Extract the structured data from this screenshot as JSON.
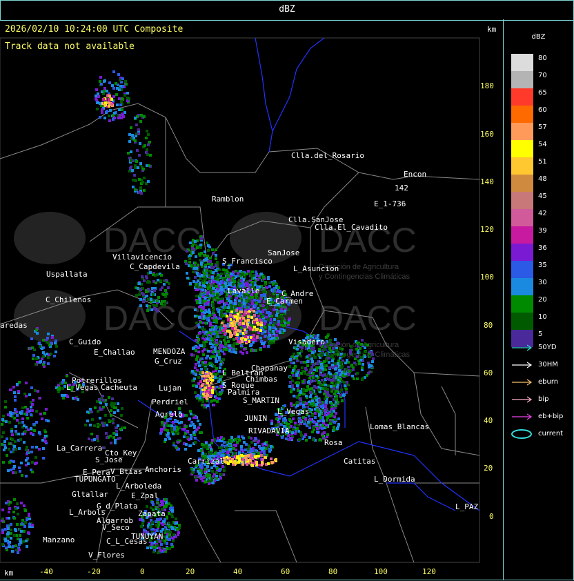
{
  "window": {
    "title": "dBZ"
  },
  "header": {
    "timestamp": "2026/02/10 10:24:00 UTC Composite",
    "track_message": "Track data not available",
    "km_label_top": "km",
    "km_label_bottom": "km"
  },
  "axes": {
    "x_ticks": [
      "-40",
      "-20",
      "0",
      "20",
      "40",
      "60",
      "80",
      "100",
      "120"
    ],
    "y_ticks": [
      "180",
      "160",
      "140",
      "120",
      "100",
      "80",
      "60",
      "40",
      "20",
      "0"
    ]
  },
  "watermark": {
    "brand": "DACC",
    "subtitle_line1": "Dirección de Agricultura",
    "subtitle_line2": "y Contingencias Climáticas"
  },
  "places": [
    "Clla.del_Rosario",
    "Encon",
    "E_1-736",
    "142",
    "Ramblon",
    "Clla.SanJose",
    "Clla.El_Cavadito",
    "Villavicencio",
    "C_Capdevila",
    "S_Francisco",
    "SanJose",
    "L_Asuncion",
    "Uspallata",
    "C_Chilenos",
    "Lavalle",
    "C_Andre",
    "E_Carmen",
    "aredas",
    "MENDOZA",
    "C_Guido",
    "E_Challao",
    "G_Cruz",
    "Visadero",
    "Chapanay",
    "Potrerillos",
    "L_Vegas",
    "Cacheuta",
    "Lujan",
    "Perdriel",
    "L_Beltran",
    "S_Roque",
    "Chimbas",
    "Palmira",
    "S_MARTIN",
    "JUNIN",
    "Agrelo",
    "L_Vegas",
    "RIVADAVIA",
    "Lomas_Blancas",
    "La_Carrera",
    "Cto_Key",
    "S_Jose",
    "E_Pera",
    "TUPUNGATO",
    "V_Btias",
    "Anchoris",
    "Catitas",
    "L_Dormida",
    "Carrizal",
    "Rosa",
    "L_Arboleda",
    "E_Zpal",
    "Gltallar",
    "G_d_Plata",
    "L_Arbols",
    "Algarrob",
    "V_Seco",
    "Zapata",
    "TUNUYAN",
    "C_L_Cesas",
    "Manzano",
    "V_Flores",
    "L_PAZ"
  ],
  "legend": {
    "title": "dBZ",
    "levels": [
      {
        "label": "80",
        "color": "#dcdcdc"
      },
      {
        "label": "70",
        "color": "#b4b4b4"
      },
      {
        "label": "65",
        "color": "#ff3a2a"
      },
      {
        "label": "60",
        "color": "#ff6a00"
      },
      {
        "label": "57",
        "color": "#ff9a5a"
      },
      {
        "label": "54",
        "color": "#ffff00"
      },
      {
        "label": "51",
        "color": "#ffc830"
      },
      {
        "label": "48",
        "color": "#d08a40"
      },
      {
        "label": "45",
        "color": "#c87878"
      },
      {
        "label": "42",
        "color": "#d05a9a"
      },
      {
        "label": "39",
        "color": "#c81aa0"
      },
      {
        "label": "36",
        "color": "#7a1ad2"
      },
      {
        "label": "35",
        "color": "#2a5ae6"
      },
      {
        "label": "30",
        "color": "#1a8ae0"
      },
      {
        "label": "20",
        "color": "#008a00"
      },
      {
        "label": "10",
        "color": "#005a00"
      },
      {
        "label": "5",
        "color": "#4a2a9a"
      }
    ],
    "tracks": [
      {
        "label": "50YD",
        "color": "#33dddd"
      },
      {
        "label": "30HM",
        "color": "#ffffff"
      },
      {
        "label": "eburn",
        "color": "#ffc070"
      },
      {
        "label": "bip",
        "color": "#ffb0c8"
      },
      {
        "label": "eb+bip",
        "color": "#ee44ee"
      },
      {
        "label": "current",
        "color": "#33dddd"
      }
    ]
  }
}
